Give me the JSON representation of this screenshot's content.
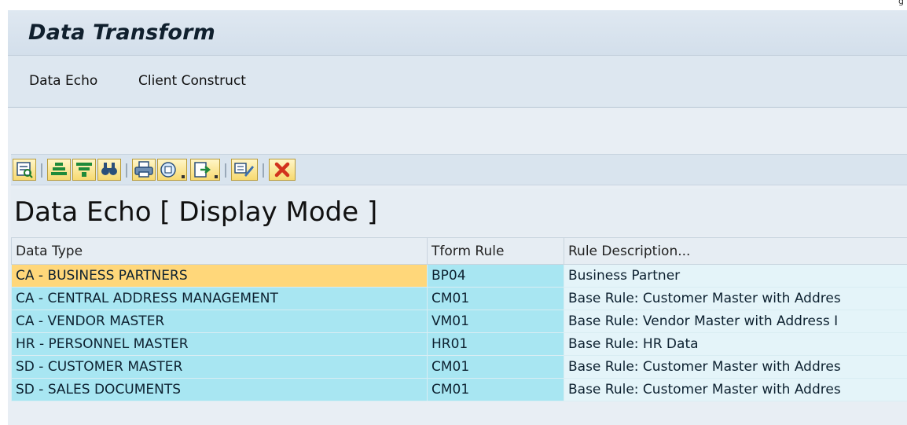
{
  "window": {
    "corner_text": "g"
  },
  "app": {
    "title": "Data Transform"
  },
  "menu": {
    "items": [
      {
        "label": "Data Echo"
      },
      {
        "label": "Client Construct"
      }
    ]
  },
  "toolbar": {
    "buttons": [
      {
        "icon": "details-icon"
      },
      {
        "icon": "sort-ascending-icon"
      },
      {
        "icon": "filter-icon"
      },
      {
        "icon": "find-icon"
      },
      {
        "icon": "print-icon"
      },
      {
        "icon": "views-icon"
      },
      {
        "icon": "export-icon"
      },
      {
        "icon": "change-layout-icon"
      },
      {
        "icon": "cancel-icon"
      }
    ]
  },
  "grid": {
    "title": "Data Echo [ Display Mode ]",
    "columns": [
      "Data Type",
      "Tform Rule",
      "Rule Description..."
    ],
    "rows": [
      {
        "data_type": "CA - BUSINESS PARTNERS",
        "tform_rule": "BP04",
        "description": "Business Partner"
      },
      {
        "data_type": "CA - CENTRAL ADDRESS MANAGEMENT",
        "tform_rule": "CM01",
        "description": "Base Rule: Customer Master with Addres"
      },
      {
        "data_type": "CA - VENDOR MASTER",
        "tform_rule": "VM01",
        "description": "Base Rule: Vendor Master with Address I"
      },
      {
        "data_type": "HR - PERSONNEL MASTER",
        "tform_rule": "HR01",
        "description": "Base Rule: HR Data"
      },
      {
        "data_type": "SD - CUSTOMER MASTER",
        "tform_rule": "CM01",
        "description": "Base Rule: Customer Master with Addres"
      },
      {
        "data_type": "SD - SALES DOCUMENTS",
        "tform_rule": "CM01",
        "description": "Base Rule: Customer Master with Addres"
      }
    ],
    "selected_row": 0
  },
  "colors": {
    "row_bg": "#a8e6f2",
    "selected_cell": "#ffd77a",
    "header_bg": "#e6edf3",
    "button_bg": "#f7d970"
  }
}
